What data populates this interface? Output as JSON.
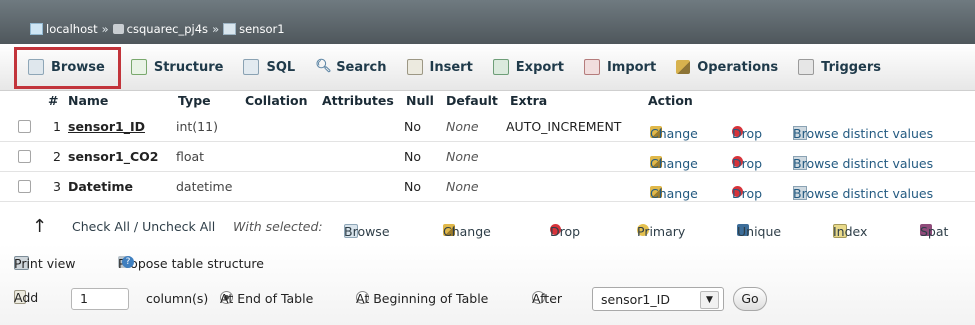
{
  "breadcrumb": {
    "host": "localhost",
    "database": "csquarec_pj4s",
    "table": "sensor1",
    "separator": "»"
  },
  "tabs": [
    {
      "label": "Browse",
      "icon": "browse-icon",
      "active": true
    },
    {
      "label": "Structure",
      "icon": "structure-icon"
    },
    {
      "label": "SQL",
      "icon": "sql-icon"
    },
    {
      "label": "Search",
      "icon": "search-icon"
    },
    {
      "label": "Insert",
      "icon": "insert-icon"
    },
    {
      "label": "Export",
      "icon": "export-icon"
    },
    {
      "label": "Import",
      "icon": "import-icon"
    },
    {
      "label": "Operations",
      "icon": "operations-icon"
    },
    {
      "label": "Triggers",
      "icon": "triggers-icon"
    }
  ],
  "columns_header": {
    "num": "#",
    "name": "Name",
    "type": "Type",
    "collation": "Collation",
    "attributes": "Attributes",
    "null": "Null",
    "default": "Default",
    "extra": "Extra",
    "action": "Action"
  },
  "rows": [
    {
      "num": "1",
      "name": "sensor1_ID",
      "type": "int(11)",
      "null": "No",
      "default": "None",
      "extra": "AUTO_INCREMENT"
    },
    {
      "num": "2",
      "name": "sensor1_CO2",
      "type": "float",
      "null": "No",
      "default": "None",
      "extra": ""
    },
    {
      "num": "3",
      "name": "Datetime",
      "type": "datetime",
      "null": "No",
      "default": "None",
      "extra": ""
    }
  ],
  "row_actions": {
    "change": "Change",
    "drop": "Drop",
    "browse_distinct": "Browse distinct values"
  },
  "with_selected": {
    "check_all": "Check All / Uncheck All",
    "label": "With selected:",
    "browse": "Browse",
    "change": "Change",
    "drop": "Drop",
    "primary": "Primary",
    "unique": "Unique",
    "index": "Index",
    "spatial": "Spat"
  },
  "bottom": {
    "print_view": "Print view",
    "propose": "Propose table structure",
    "add": "Add",
    "add_count": "1",
    "columns_label": "column(s)",
    "at_end": "At End of Table",
    "at_beginning": "At Beginning of Table",
    "after": "After",
    "after_select": "sensor1_ID",
    "go": "Go"
  },
  "colors": {
    "active_tab_outline": "#c2343b",
    "link": "#235a81",
    "breadcrumb_bg": "#5a6368"
  }
}
